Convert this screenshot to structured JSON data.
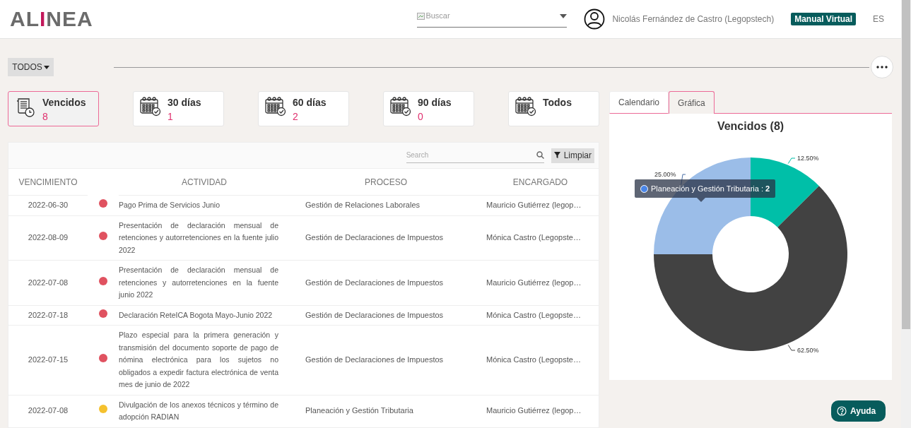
{
  "header": {
    "logo": "ALINEA",
    "search": {
      "placeholder": "Buscar"
    },
    "user": "Nicolás Fernández de Castro (Legopstech)",
    "manual": "Manual Virtual",
    "language": "ES"
  },
  "filter": {
    "label": "TODOS"
  },
  "cards": [
    {
      "kind": "overdue",
      "title": "Vencidos",
      "count": "8",
      "selected": true
    },
    {
      "kind": "calendar",
      "title": "30 días",
      "count": "1",
      "selected": false
    },
    {
      "kind": "calendar",
      "title": "60 días",
      "count": "2",
      "selected": false
    },
    {
      "kind": "calendar",
      "title": "90 días",
      "count": "0",
      "selected": false
    },
    {
      "kind": "calendar",
      "title": "Todos",
      "selected": false
    }
  ],
  "table": {
    "search": {
      "placeholder": "Search"
    },
    "clear": "Limpiar",
    "columns": [
      "VENCIMIENTO",
      "ACTIVIDAD",
      "PROCESO",
      "ENCARGADO"
    ],
    "rows": [
      {
        "date": "2022-06-30",
        "color": "#e05260",
        "activity": "Pago Prima de Servicios Junio",
        "process": "Gestión de Relaciones Laborales",
        "owner": "Mauricio Gutiérrez (legop…"
      },
      {
        "date": "2022-08-09",
        "color": "#e05260",
        "activity": "Presentación de declaración mensual de retenciones y autorretenciones en la fuente julio 2022",
        "process": "Gestión de Declaraciones de Impuestos",
        "owner": "Mónica Castro (Legopste…"
      },
      {
        "date": "2022-07-08",
        "color": "#e05260",
        "activity": "Presentación de declaración mensual de retenciones y autorretenciones en la fuente junio 2022",
        "process": "Gestión de Declaraciones de Impuestos",
        "owner": "Mauricio Gutiérrez (legop…"
      },
      {
        "date": "2022-07-18",
        "color": "#e05260",
        "activity": "Declaración ReteICA Bogota Mayo-Junio 2022",
        "process": "Gestión de Declaraciones de Impuestos",
        "owner": "Mónica Castro (Legopste…"
      },
      {
        "date": "2022-07-15",
        "color": "#e05260",
        "activity": "Plazo especial para la primera generación y transmisión del documento soporte de pago de nómina electrónica para los sujetos no obligados a expedir factura electrónica de venta mes de junio de 2022",
        "process": "Gestión de Declaraciones de Impuestos",
        "owner": "Mónica Castro (Legopste…"
      },
      {
        "date": "2022-07-08",
        "color": "#f5c12e",
        "activity": "Divulgación de los anexos técnicos y término de adopción RADIAN",
        "process": "Planeación y Gestión Tributaria",
        "owner": "Mauricio Gutiérrez (legop…"
      }
    ]
  },
  "tabs": [
    {
      "label": "Calendario",
      "selected": false
    },
    {
      "label": "Gráfica",
      "selected": true
    }
  ],
  "chart_data": {
    "type": "donut",
    "title": "Vencidos (8)",
    "values": [
      12.5,
      62.5,
      25
    ],
    "value_labels": [
      "12.50%",
      "62.50%",
      "25.00%"
    ]
  },
  "tooltip": {
    "label": "Planeación y Gestión Tributaria",
    "separator": ":",
    "value": "2",
    "color": "#4a86e8"
  },
  "help": "Ayuda"
}
